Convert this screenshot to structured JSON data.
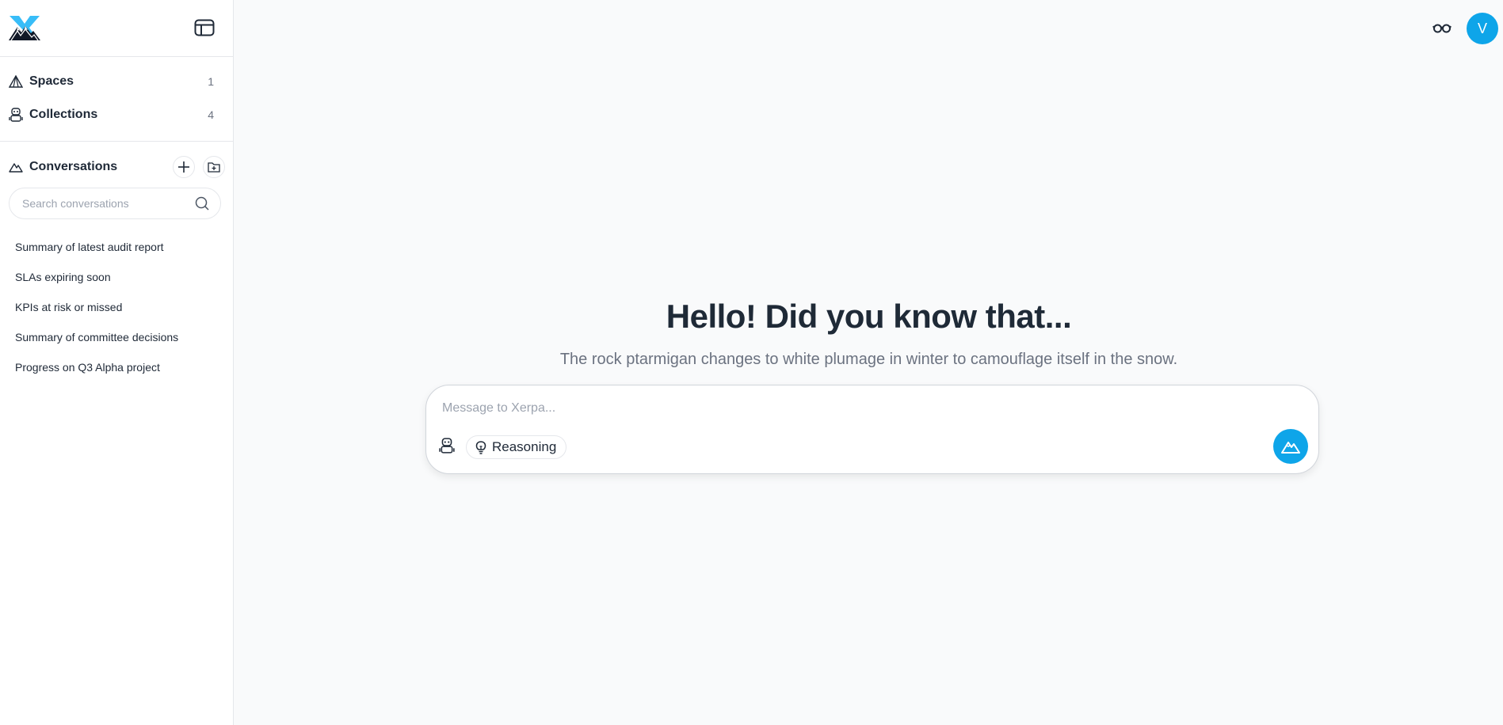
{
  "app": {
    "name": "Xerpa"
  },
  "sidebar": {
    "nav": [
      {
        "label": "Spaces",
        "count": "1",
        "icon": "tent-icon"
      },
      {
        "label": "Collections",
        "count": "4",
        "icon": "robot-icon"
      }
    ],
    "conversations": {
      "label": "Conversations",
      "search_placeholder": "Search conversations",
      "items": [
        {
          "label": "Summary of latest audit report"
        },
        {
          "label": "SLAs expiring soon"
        },
        {
          "label": "KPIs at risk or missed"
        },
        {
          "label": "Summary of committee decisions"
        },
        {
          "label": "Progress on Q3 Alpha project"
        }
      ]
    }
  },
  "header": {
    "avatar_initial": "V"
  },
  "main": {
    "title": "Hello! Did you know that...",
    "subtitle": "The rock ptarmigan changes to white plumage in winter to camouflage itself in the snow.",
    "composer": {
      "placeholder": "Message to Xerpa...",
      "value": "",
      "reasoning_label": "Reasoning"
    }
  },
  "colors": {
    "accent": "#0ea5e9",
    "text": "#1f2937",
    "muted": "#6b7280",
    "background": "#f9fafb"
  }
}
